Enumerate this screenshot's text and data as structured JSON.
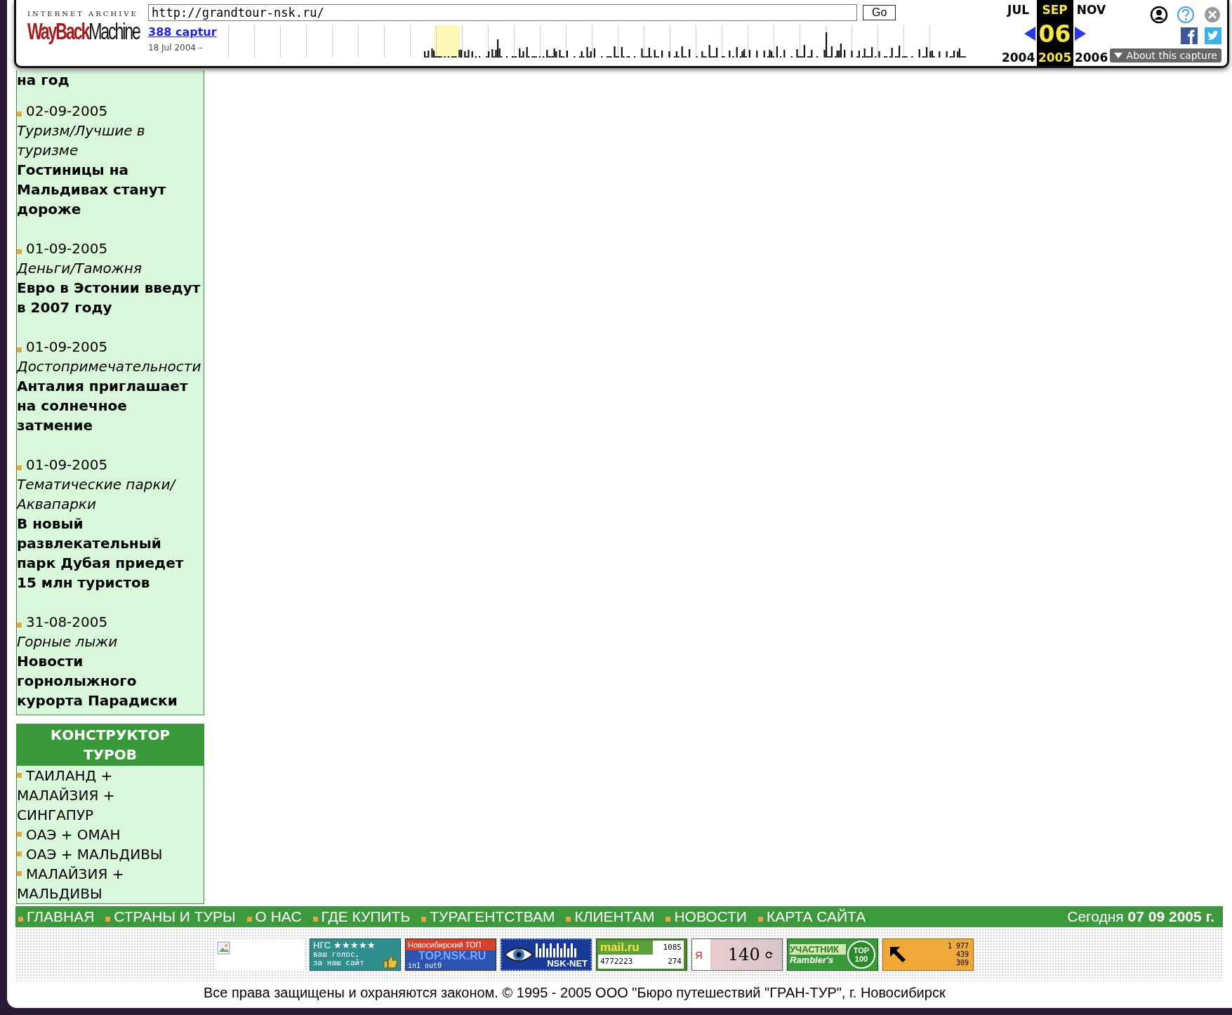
{
  "toolbar": {
    "logo_top": "INTERNET ARCHIVE",
    "logo_first": "WayBack",
    "logo_second": "Machine",
    "url": "http://grandtour-nsk.ru/",
    "go": "Go",
    "captures_link": "388 captur",
    "capture_range": "18 Jul 2004 –",
    "months": [
      {
        "month": "JUL",
        "year": "2004",
        "selected": false
      },
      {
        "month": "SEP",
        "year": "2005",
        "selected": true
      },
      {
        "month": "NOV",
        "year": "2006",
        "selected": false
      }
    ],
    "day": "06",
    "about": "About this capture"
  },
  "sidebar": {
    "partial_headline": "на год",
    "news": [
      {
        "date": "02-09-2005",
        "category": "Туризм/Лучшие в туризме",
        "headline": "Гостиницы на Мальдивах станут дороже"
      },
      {
        "date": "01-09-2005",
        "category": "Деньги/Таможня",
        "headline": "Евро в Эстонии введут в 2007 году"
      },
      {
        "date": "01-09-2005",
        "category": "Достопримечательности",
        "headline": "Анталия приглашает на солнечное затмение"
      },
      {
        "date": "01-09-2005",
        "category": "Тематические парки/ Аквапарки",
        "headline": "В новый развлекательный парк Дубая приедет 15 млн туристов"
      },
      {
        "date": "31-08-2005",
        "category": "Горные лыжи",
        "headline": "Новости горнолыжного курорта Парадиски"
      }
    ],
    "constructor_title": "КОНСТРУКТОР ТУРОВ",
    "tours": [
      "ТАИЛАНД + МАЛАЙЗИЯ + СИНГАПУР",
      "ОАЭ + ОМАН",
      "ОАЭ + МАЛЬДИВЫ",
      "МАЛАЙЗИЯ + МАЛЬДИВЫ"
    ]
  },
  "nav": {
    "items": [
      "ГЛАВНАЯ",
      "СТРАНЫ И ТУРЫ",
      "О НАС",
      "ГДЕ КУПИТЬ",
      "ТУРАГЕНТСТВАМ",
      "КЛИЕНТАМ",
      "НОВОСТИ",
      "КАРТА САЙТА"
    ],
    "today": "Сегодня **07 09 2005 г.**"
  },
  "banners": [
    {
      "kind": "broken"
    },
    {
      "kind": "ngs",
      "lines": [
        "НГС ★★★★★",
        "ваш голос,",
        "за наш сайт"
      ]
    },
    {
      "kind": "topnsk",
      "lines": [
        "Новосибирский ТОП",
        "TOP.NSK.RU",
        "in1 out0"
      ]
    },
    {
      "kind": "nsknet",
      "lines": [
        "NSK-NET"
      ]
    },
    {
      "kind": "mailru",
      "lines": [
        "mail.ru",
        "1085",
        "4772223",
        "274"
      ]
    },
    {
      "kind": "yandex",
      "lines": [
        "Я",
        "140"
      ]
    },
    {
      "kind": "rambler",
      "lines": [
        "УЧАСТНИК",
        "Rambler's",
        "TOP",
        "100"
      ]
    },
    {
      "kind": "counter",
      "lines": [
        "1 977",
        "439",
        "309"
      ]
    }
  ],
  "footer": "Все права защищены и охраняются законом. © 1995 - 2005 ООО \"Бюро путешествий \"ГРАН-ТУР\", г. Новосибирск"
}
